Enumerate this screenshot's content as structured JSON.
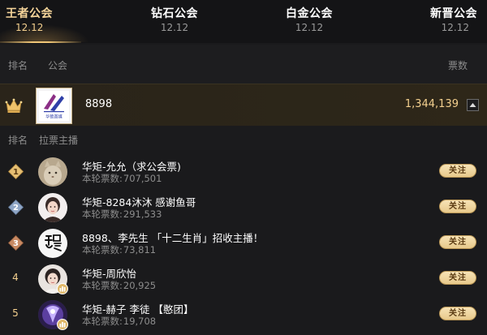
{
  "tabs": [
    {
      "name": "王者公会",
      "date": "12.12",
      "active": true
    },
    {
      "name": "钻石公会",
      "date": "12.12",
      "active": false
    },
    {
      "name": "白金公会",
      "date": "12.12",
      "active": false
    },
    {
      "name": "新晋公会",
      "date": "12.12",
      "active": false
    }
  ],
  "guild_header": {
    "rank_label": "排名",
    "guild_label": "公会",
    "votes_label": "票数"
  },
  "guild": {
    "name": "8898",
    "votes": "1,344,139",
    "logo_text": "华铯首媒"
  },
  "streamer_header": {
    "rank_label": "排名",
    "streamer_label": "拉票主播"
  },
  "streamers": [
    {
      "rank": "1",
      "name": "华矩-允允（求公会票)",
      "votes_label": "本轮票数:",
      "votes": "707,501",
      "follow": "关注"
    },
    {
      "rank": "2",
      "name": "华矩-8284沐沐 感谢鱼哥",
      "votes_label": "本轮票数:",
      "votes": "291,533",
      "follow": "关注"
    },
    {
      "rank": "3",
      "name": "8898、李先生 「十二生肖」招收主播！",
      "votes_label": "本轮票数:",
      "votes": "73,811",
      "follow": "关注"
    },
    {
      "rank": "4",
      "name": "华矩-周欣怡",
      "votes_label": "本轮票数:",
      "votes": "20,925",
      "follow": "关注"
    },
    {
      "rank": "5",
      "name": "华矩-赫子 李徒 【憨团】",
      "votes_label": "本轮票数:",
      "votes": "19,708",
      "follow": "关注"
    }
  ],
  "colors": {
    "accent_gold": "#f3cf8e",
    "background": "#1a1a1c",
    "rank1": "#e6bf73",
    "rank2": "#8fa6c6",
    "rank3": "#c98a63"
  },
  "icons": {
    "crown": "crown-icon",
    "collapse": "chevron-up-icon",
    "host_badge": "host-level-icon"
  }
}
